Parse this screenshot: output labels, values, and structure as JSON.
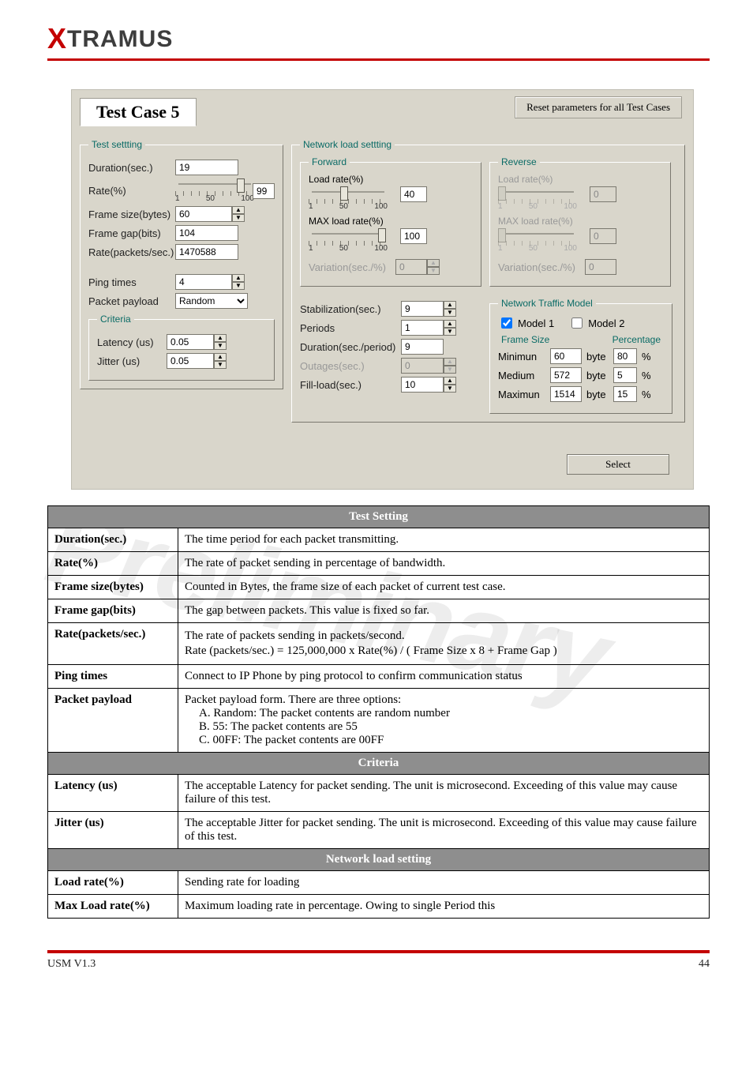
{
  "logo": {
    "x": "X",
    "rest": "TRAMUS"
  },
  "tab": {
    "title": "Test Case 5"
  },
  "reset_btn": "Reset parameters for all Test Cases",
  "select_btn": "Select",
  "watermark": "Preliminary",
  "test_setting": {
    "legend": "Test settting",
    "duration_label": "Duration(sec.)",
    "duration_value": "19",
    "rate_label": "Rate(%)",
    "rate_value": "99",
    "rate_ticks": {
      "a": "1",
      "b": "50",
      "c": "100"
    },
    "frame_size_label": "Frame size(bytes)",
    "frame_size_value": "60",
    "frame_gap_label": "Frame gap(bits)",
    "frame_gap_value": "104",
    "rate_pps_label": "Rate(packets/sec.)",
    "rate_pps_value": "1470588",
    "ping_label": "Ping times",
    "ping_value": "4",
    "payload_label": "Packet payload",
    "payload_value": "Random",
    "criteria_legend": "Criteria",
    "latency_label": "Latency (us)",
    "latency_value": "0.05",
    "jitter_label": "Jitter (us)",
    "jitter_value": "0.05"
  },
  "network_load": {
    "legend": "Network load settting",
    "forward_legend": "Forward",
    "reverse_legend": "Reverse",
    "load_rate_label": "Load rate(%)",
    "max_load_label": "MAX load rate(%)",
    "variation_label": "Variation(sec./%)",
    "ticks": {
      "a": "1",
      "b": "50",
      "c": "100"
    },
    "forward": {
      "load_rate": "40",
      "max_load": "100",
      "variation": "0"
    },
    "reverse": {
      "load_rate": "0",
      "max_load": "0",
      "variation": "0"
    },
    "stab_label": "Stabilization(sec.)",
    "stab_value": "9",
    "periods_label": "Periods",
    "periods_value": "1",
    "dur_per_label": "Duration(sec./period)",
    "dur_per_value": "9",
    "outages_label": "Outages(sec.)",
    "outages_value": "0",
    "fill_label": "Fill-load(sec.)",
    "fill_value": "10"
  },
  "ntm": {
    "legend": "Network Traffic Model",
    "model1": "Model 1",
    "model2": "Model 2",
    "frame_size": "Frame Size",
    "percentage": "Percentage",
    "min_label": "Minimun",
    "min_val": "60",
    "min_pct": "80",
    "med_label": "Medium",
    "med_val": "572",
    "med_pct": "5",
    "max_label": "Maximun",
    "max_val": "1514",
    "max_pct": "15",
    "byte": "byte",
    "pct": "%"
  },
  "table": {
    "section_test": "Test Setting",
    "section_criteria": "Criteria",
    "section_load": "Network load setting",
    "rows_test": {
      "duration": {
        "name": "Duration(sec.)",
        "desc": "The time period for each packet transmitting."
      },
      "rate": {
        "name": "Rate(%)",
        "desc": "The rate of packet sending in percentage of bandwidth."
      },
      "frame_size": {
        "name": "Frame size(bytes)",
        "desc": "Counted in Bytes, the frame size of each packet of current test case."
      },
      "frame_gap": {
        "name": "Frame gap(bits)",
        "desc": "The gap between packets. This value is fixed so far."
      },
      "rate_pps": {
        "name": "Rate(packets/sec.)",
        "desc": "The rate of packets sending in packets/second.",
        "formula": "Rate (packets/sec.) = 125,000,000 x Rate(%) / ( Frame Size x 8 + Frame Gap )"
      },
      "ping": {
        "name": "Ping times",
        "desc": "Connect to IP Phone by ping protocol to confirm communication status"
      },
      "payload": {
        "name": "Packet payload",
        "desc": "Packet payload form. There are three options:",
        "a": "A. Random: The packet contents are random number",
        "b": "B. 55: The packet contents are 55",
        "c": "C. 00FF: The packet contents are 00FF"
      }
    },
    "rows_criteria": {
      "latency": {
        "name": "Latency (us)",
        "desc": "The acceptable Latency for packet sending. The unit is microsecond. Exceeding of this value may cause failure of this test."
      },
      "jitter": {
        "name": "Jitter (us)",
        "desc": "The acceptable Jitter for packet sending. The unit is microsecond. Exceeding of this value may cause failure of this test."
      }
    },
    "rows_load": {
      "load_rate": {
        "name": "Load rate(%)",
        "desc": "Sending rate for loading"
      },
      "max_load": {
        "name": "Max Load rate(%)",
        "desc": "Maximum loading rate in percentage. Owing to single Period this"
      }
    }
  },
  "footer": {
    "left": "USM V1.3",
    "right": "44"
  }
}
